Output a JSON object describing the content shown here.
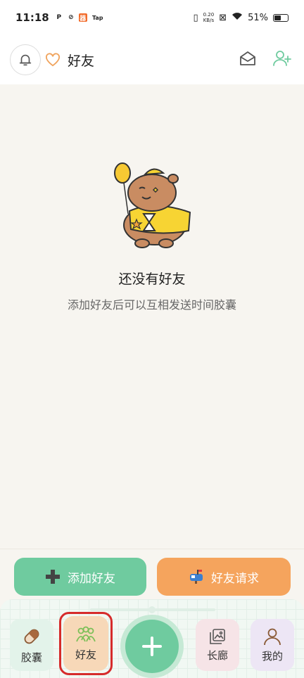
{
  "status_bar": {
    "time": "11:18",
    "tap_label": "Tap",
    "app_badge": "器",
    "network_speed_value": "0.20",
    "network_speed_unit": "KB/s",
    "battery": "51%"
  },
  "header": {
    "title": "好友"
  },
  "empty_state": {
    "title": "还没有好友",
    "subtitle": "添加好友后可以互相发送时间胶囊"
  },
  "actions": {
    "add_friend": "添加好友",
    "friend_requests": "好友请求"
  },
  "bottom_nav": {
    "items": [
      {
        "label": "胶囊"
      },
      {
        "label": "好友"
      },
      {
        "label": "长廊"
      },
      {
        "label": "我的"
      }
    ],
    "active_index": 1
  },
  "colors": {
    "green": "#6fcb9f",
    "orange": "#f5a45d",
    "highlight": "#d62b2b"
  }
}
